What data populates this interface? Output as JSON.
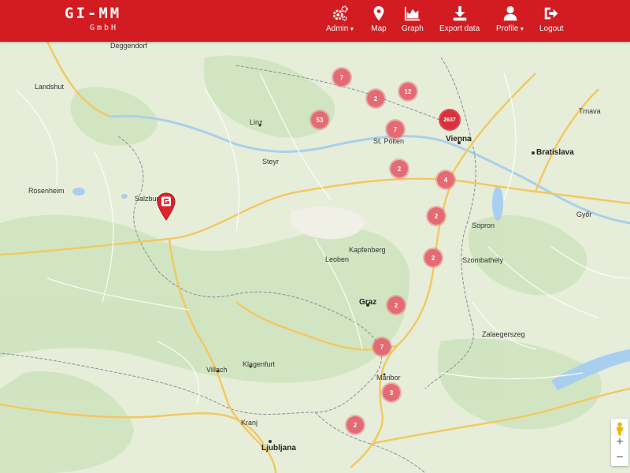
{
  "brand": {
    "name": "GI-MM",
    "subtitle": "GmbH"
  },
  "nav": [
    {
      "label": "Admin",
      "icon": "gears-icon",
      "dropdown": true
    },
    {
      "label": "Map",
      "icon": "map-marker-icon",
      "dropdown": false
    },
    {
      "label": "Graph",
      "icon": "area-chart-icon",
      "dropdown": false
    },
    {
      "label": "Export data",
      "icon": "download-icon",
      "dropdown": false
    },
    {
      "label": "Profile",
      "icon": "user-icon",
      "dropdown": true
    },
    {
      "label": "Logout",
      "icon": "logout-icon",
      "dropdown": false
    }
  ],
  "colors": {
    "navbar": "#d21c22",
    "cluster": "#e46a74",
    "cluster_large": "#d9303c",
    "water": "#a9cfee",
    "land": "#e8f0dc"
  },
  "clusters": [
    {
      "count": "7"
    },
    {
      "count": "2"
    },
    {
      "count": "12"
    },
    {
      "count": "2637"
    },
    {
      "count": "53"
    },
    {
      "count": "7"
    },
    {
      "count": "2"
    },
    {
      "count": "4"
    },
    {
      "count": "2"
    },
    {
      "count": "2"
    },
    {
      "count": "2"
    },
    {
      "count": "7"
    },
    {
      "count": "3"
    },
    {
      "count": "2"
    }
  ],
  "cities": [
    "Vienna",
    "Bratislava",
    "Graz",
    "Ljubljana",
    "Klagenfurt",
    "Villach",
    "Linz",
    "Salzburg",
    "Maribor",
    "St. Pölten",
    "Szombathely",
    "Győr",
    "Zalaegerszeg",
    "Rosenheim",
    "Deggendorf",
    "Landshut",
    "Steyr",
    "Leoben",
    "Kapfenberg",
    "Kranj",
    "Trnava",
    "Sopron"
  ],
  "map_controls": {
    "zoom_in": "+",
    "zoom_out": "−"
  }
}
